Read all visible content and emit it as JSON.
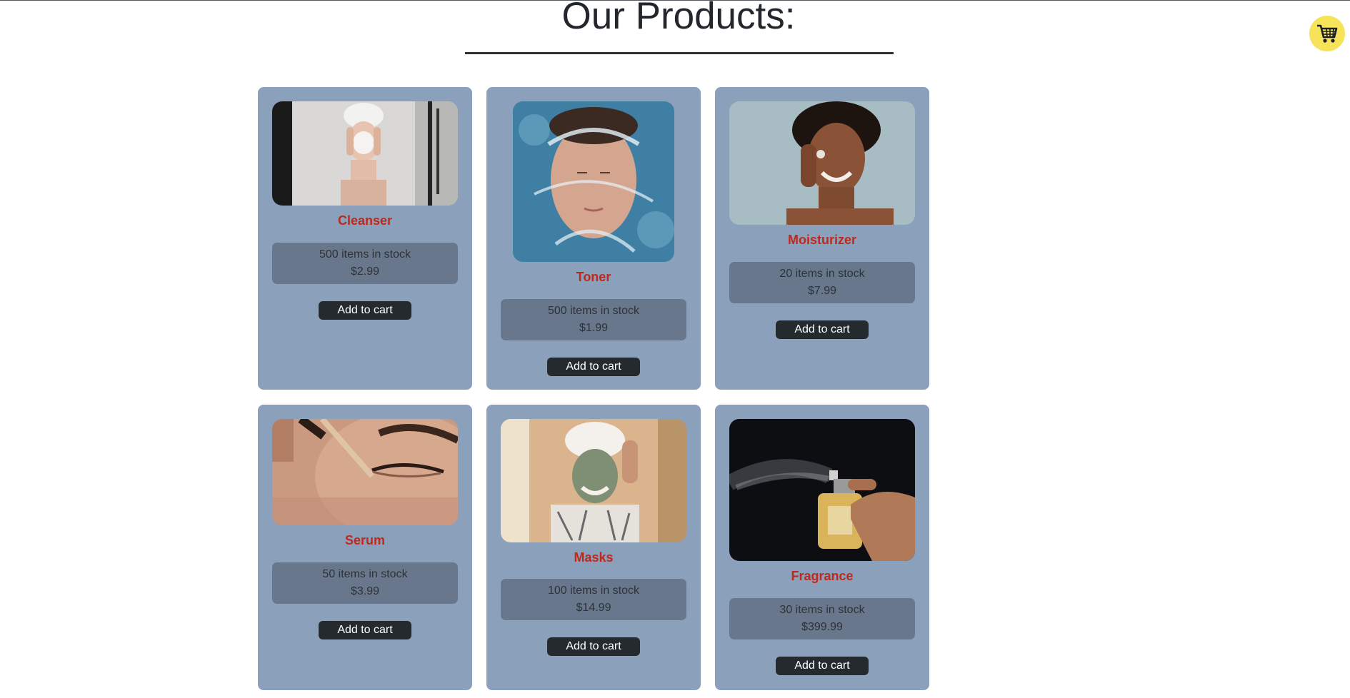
{
  "page": {
    "title": "Our Products:"
  },
  "cart": {
    "icon": "shopping-cart-icon",
    "accent": "#f7e35a"
  },
  "colors": {
    "card_bg": "#8aa0bb",
    "info_bg": "#68778b",
    "name_color": "#c0281c",
    "button_bg": "#252a2f"
  },
  "products": [
    {
      "name": "Cleanser",
      "stock": "500 items in stock",
      "price": "$2.99",
      "button": "Add to cart",
      "image": "woman-washing-face-photo"
    },
    {
      "name": "Toner",
      "stock": "500 items in stock",
      "price": "$1.99",
      "button": "Add to cart",
      "image": "woman-water-splash-photo"
    },
    {
      "name": "Moisturizer",
      "stock": "20 items in stock",
      "price": "$7.99",
      "button": "Add to cart",
      "image": "woman-applying-cream-photo"
    },
    {
      "name": "Serum",
      "stock": "50 items in stock",
      "price": "$3.99",
      "button": "Add to cart",
      "image": "serum-dropper-eye-photo"
    },
    {
      "name": "Masks",
      "stock": "100 items in stock",
      "price": "$14.99",
      "button": "Add to cart",
      "image": "woman-face-mask-photo"
    },
    {
      "name": "Fragrance",
      "stock": "30 items in stock",
      "price": "$399.99",
      "button": "Add to cart",
      "image": "perfume-spray-photo"
    }
  ]
}
